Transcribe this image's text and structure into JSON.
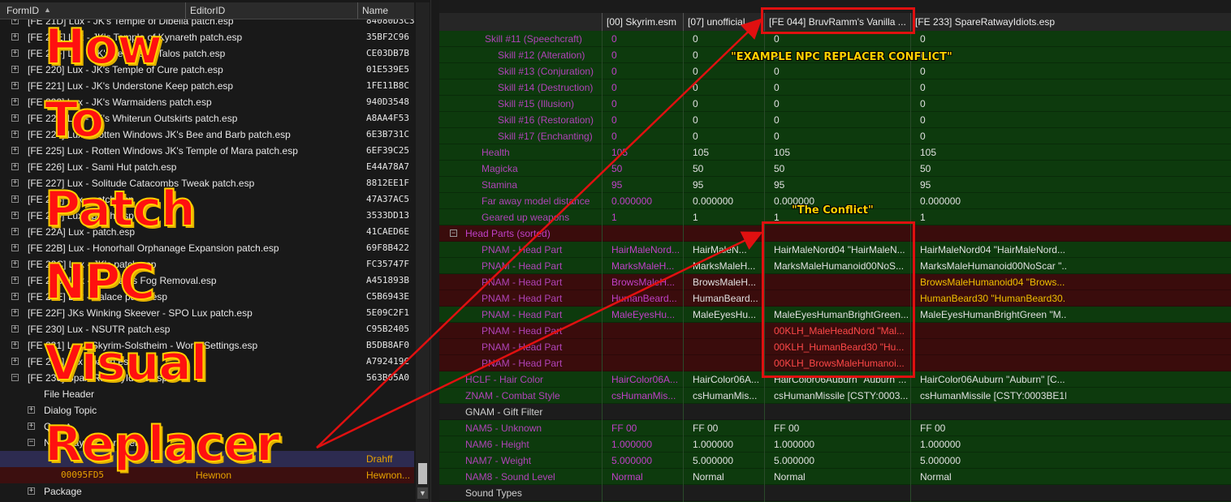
{
  "left_header": {
    "col1": "FormID",
    "col2": "EditorID",
    "col3": "Name"
  },
  "left_rows": [
    {
      "name": "[FE 21D] Lux - JK's Temple of Dibella patch.esp",
      "fid": "84080D3C3"
    },
    {
      "name": "[FE 21E] Lux - JK's Temple of Kynareth patch.esp",
      "fid": "35BF2C96"
    },
    {
      "name": "[FE 21F] Lux - JK's Temple of Talos patch.esp",
      "fid": "CE03DB7B"
    },
    {
      "name": "[FE 220] Lux - JK's Temple of Cure patch.esp",
      "fid": "01E539E5"
    },
    {
      "name": "[FE 221] Lux - JK's Understone Keep patch.esp",
      "fid": "1FE11B8C"
    },
    {
      "name": "[FE 222] Lux - JK's Warmaidens patch.esp",
      "fid": "940D3548"
    },
    {
      "name": "[FE 223] Lux - JK's Whiterun Outskirts patch.esp",
      "fid": "A8AA4F53"
    },
    {
      "name": "[FE 224] Lux - Rotten Windows JK's Bee and Barb patch.esp",
      "fid": "6E3B731C"
    },
    {
      "name": "[FE 225] Lux - Rotten Windows JK's Temple of Mara patch.esp",
      "fid": "6EF39C25"
    },
    {
      "name": "[FE 226] Lux - Sami Hut patch.esp",
      "fid": "E44A78A7"
    },
    {
      "name": "[FE 227] Lux - Solitude Catacombs Tweak patch.esp",
      "fid": "8812EE1F"
    },
    {
      "name": "[FE 228] Lux - patch.esp",
      "fid": "47A37AC5"
    },
    {
      "name": "[FE 229] Lux - patch.esp",
      "fid": "3533DD13"
    },
    {
      "name": "[FE 22A] Lux - patch.esp",
      "fid": "41CAED6E"
    },
    {
      "name": "[FE 22B] Lux - Honorhall Orphanage Expansion patch.esp",
      "fid": "69F8B422"
    },
    {
      "name": "[FE 22C] Lux - JK's patch.esp",
      "fid": "FC35747F"
    },
    {
      "name": "[FE 22D] Lux - Templates Fog Removal.esp",
      "fid": "A451893B"
    },
    {
      "name": "[FE 22E] Lux - Palace patch.esp",
      "fid": "C5B6943E"
    },
    {
      "name": "[FE 22F] JKs Winking Skeever - SPO Lux patch.esp",
      "fid": "5E09C2F1"
    },
    {
      "name": "[FE 230] Lux - NSUTR patch.esp",
      "fid": "C95B2405"
    },
    {
      "name": "[FE 231] Lux - Skyrim-Solstheim - World Settings.esp",
      "fid": "B5DB8AF0"
    },
    {
      "name": "[FE 232] Lux - patch.esp",
      "fid": "A792419C"
    },
    {
      "name": "[FE 233] SpareRatwayIdiots.esp",
      "fid": "563B05A0"
    }
  ],
  "left_sub": {
    "file_header": "File Header",
    "dialog_topic": "Dialog Topic",
    "quest": "Quest",
    "npc": "Non-Player Character",
    "sel_fid": "",
    "sel_name": "Drahff",
    "row2_fid": "00095FD5",
    "row2_editor": "Hewnon",
    "row2_name": "Hewnon...",
    "package": "Package"
  },
  "right_header": {
    "c0": "[00] Skyrim.esm",
    "c1": "[07] unofficial ...",
    "c2": "[FE 044] BruvRamm's Vanilla ...",
    "c3": "[FE 233] SpareRatwayIdiots.esp"
  },
  "right_rows": [
    {
      "type": "g",
      "indent": 56,
      "label": "Skill #11 (Speechcraft)",
      "v": [
        "0",
        "0",
        "0",
        "0"
      ]
    },
    {
      "type": "g",
      "indent": 72,
      "label": "Skill #12 (Alteration)",
      "v": [
        "0",
        "0",
        "0",
        "0"
      ]
    },
    {
      "type": "g",
      "indent": 72,
      "label": "Skill #13 (Conjuration)",
      "v": [
        "0",
        "0",
        "0",
        "0"
      ]
    },
    {
      "type": "g",
      "indent": 72,
      "label": "Skill #14 (Destruction)",
      "v": [
        "0",
        "0",
        "0",
        "0"
      ]
    },
    {
      "type": "g",
      "indent": 72,
      "label": "Skill #15 (Illusion)",
      "v": [
        "0",
        "0",
        "0",
        "0"
      ]
    },
    {
      "type": "g",
      "indent": 72,
      "label": "Skill #16 (Restoration)",
      "v": [
        "0",
        "0",
        "0",
        "0"
      ]
    },
    {
      "type": "g",
      "indent": 72,
      "label": "Skill #17 (Enchanting)",
      "v": [
        "0",
        "0",
        "0",
        "0"
      ]
    },
    {
      "type": "g",
      "indent": 52,
      "label": "Health",
      "v": [
        "105",
        "105",
        "105",
        "105"
      ]
    },
    {
      "type": "g",
      "indent": 52,
      "label": "Magicka",
      "v": [
        "50",
        "50",
        "50",
        "50"
      ]
    },
    {
      "type": "g",
      "indent": 52,
      "label": "Stamina",
      "v": [
        "95",
        "95",
        "95",
        "95"
      ]
    },
    {
      "type": "g",
      "indent": 52,
      "label": "Far away model distance",
      "v": [
        "0.000000",
        "0.000000",
        "0.000000",
        "0.000000"
      ]
    },
    {
      "type": "g",
      "indent": 52,
      "label": "Geared up weapons",
      "v": [
        "1",
        "1",
        "1",
        "1"
      ]
    },
    {
      "type": "r",
      "indent": 32,
      "label": "Head Parts (sorted)",
      "v": [
        "",
        "",
        "",
        ""
      ],
      "exp": true
    },
    {
      "type": "g",
      "indent": 52,
      "label": "PNAM - Head Part",
      "v": [
        "HairMaleNord...",
        "HairMaleN...",
        "HairMaleNord04 \"HairMaleN...",
        "HairMaleNord04 \"HairMaleNord..."
      ]
    },
    {
      "type": "g",
      "indent": 52,
      "label": "PNAM - Head Part",
      "v": [
        "MarksMaleH...",
        "MarksMaleH...",
        "MarksMaleHumanoid00NoS...",
        "MarksMaleHumanoid00NoScar \"..."
      ]
    },
    {
      "type": "r",
      "indent": 52,
      "label": "PNAM - Head Part",
      "v": [
        "BrowsMaleH...",
        "BrowsMaleH...",
        "",
        "BrowsMaleHumanoid04 \"Brows..."
      ],
      "c3y": true
    },
    {
      "type": "r",
      "indent": 52,
      "label": "PNAM - Head Part",
      "v": [
        "HumanBeard...",
        "HumanBeard...",
        "",
        "HumanBeard30 \"HumanBeard30..."
      ],
      "c3y": true
    },
    {
      "type": "g",
      "indent": 52,
      "label": "PNAM - Head Part",
      "v": [
        "MaleEyesHu...",
        "MaleEyesHu...",
        "MaleEyesHumanBrightGreen...",
        "MaleEyesHumanBrightGreen \"M..."
      ]
    },
    {
      "type": "r",
      "indent": 52,
      "label": "PNAM - Head Part",
      "v": [
        "",
        "",
        "00KLH_MaleHeadNord \"Mal...",
        ""
      ],
      "c2r": true
    },
    {
      "type": "r",
      "indent": 52,
      "label": "PNAM - Head Part",
      "v": [
        "",
        "",
        "00KLH_HumanBeard30 \"Hu...",
        ""
      ],
      "c2r": true
    },
    {
      "type": "r",
      "indent": 52,
      "label": "PNAM - Head Part",
      "v": [
        "",
        "",
        "00KLH_BrowsMaleHumanoi...",
        ""
      ],
      "c2r": true
    },
    {
      "type": "g",
      "indent": 32,
      "label": "HCLF - Hair Color",
      "v": [
        "HairColor06A...",
        "HairColor06A...",
        "HairColor06Auburn \"Auburn\"...",
        "HairColor06Auburn \"Auburn\" [C..."
      ]
    },
    {
      "type": "g",
      "indent": 32,
      "label": "ZNAM - Combat Style",
      "v": [
        "csHumanMis...",
        "csHumanMis...",
        "csHumanMissile [CSTY:0003...",
        "csHumanMissile [CSTY:0003BE1D]"
      ]
    },
    {
      "type": "gr",
      "indent": 32,
      "label": "GNAM - Gift Filter",
      "v": [
        "",
        "",
        "",
        ""
      ],
      "grey": true
    },
    {
      "type": "g",
      "indent": 32,
      "label": "NAM5 - Unknown",
      "v": [
        "FF 00",
        "FF 00",
        "FF 00",
        "FF 00"
      ]
    },
    {
      "type": "g",
      "indent": 32,
      "label": "NAM6 - Height",
      "v": [
        "1.000000",
        "1.000000",
        "1.000000",
        "1.000000"
      ]
    },
    {
      "type": "g",
      "indent": 32,
      "label": "NAM7 - Weight",
      "v": [
        "5.000000",
        "5.000000",
        "5.000000",
        "5.000000"
      ]
    },
    {
      "type": "g",
      "indent": 32,
      "label": "NAM8 - Sound Level",
      "v": [
        "Normal",
        "Normal",
        "Normal",
        "Normal"
      ]
    },
    {
      "type": "gr",
      "indent": 32,
      "label": "Sound Types",
      "v": [
        "",
        "",
        "",
        ""
      ],
      "grey": true
    }
  ],
  "annotations": {
    "example": "\"EXAMPLE NPC REPLACER CONFLICT\"",
    "conflict": "\"The Conflict\"",
    "title_lines": [
      "How",
      "To",
      "Patch",
      "NPC",
      "Visual",
      "Replacer"
    ]
  }
}
